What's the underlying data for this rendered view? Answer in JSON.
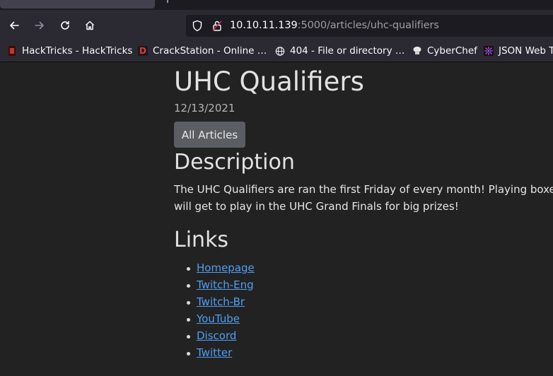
{
  "browser": {
    "url": {
      "host": "10.10.11.139",
      "rest": ":5000/articles/uhc-qualifiers"
    },
    "bookmarks": [
      {
        "label": "HackTricks - HackTricks",
        "icon": "hacktricks-icon"
      },
      {
        "label": "CrackStation - Online …",
        "icon": "crackstation-icon"
      },
      {
        "label": "404 - File or directory …",
        "icon": "globe-icon"
      },
      {
        "label": "CyberChef",
        "icon": "cyberchef-icon"
      },
      {
        "label": "JSON Web T",
        "icon": "jwt-icon"
      }
    ]
  },
  "article": {
    "title": "UHC Qualifiers",
    "date": "12/13/2021",
    "all_articles_label": "All Articles",
    "description_heading": "Description",
    "description_line1": "The UHC Qualifiers are ran the first Friday of every month! Playing boxes like",
    "description_line2": "will get to play in the UHC Grand Finals for big prizes!",
    "links_heading": "Links",
    "links": [
      "Homepage",
      "Twitch-Eng",
      "Twitch-Br",
      "YouTube",
      "Discord",
      "Twitter"
    ]
  },
  "colors": {
    "page_bg": "#222222",
    "link": "#4f9ff3",
    "button_bg": "#5a5e62",
    "toolbar_bg": "#2b2a33"
  }
}
